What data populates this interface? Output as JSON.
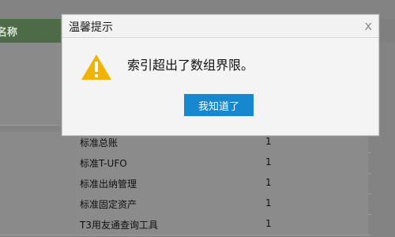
{
  "table": {
    "header_fragment": "名称",
    "rows": [
      {
        "name": "标准总账",
        "value": "1"
      },
      {
        "name": "标准T-UFO",
        "value": "1"
      },
      {
        "name": "标准出纳管理",
        "value": "1"
      },
      {
        "name": "标准固定资产",
        "value": "1"
      },
      {
        "name": "T3用友通查询工具",
        "value": "1"
      }
    ]
  },
  "dialog": {
    "title": "温馨提示",
    "close_glyph": "x",
    "message": "索引超出了数组界限。",
    "button_label": "我知道了",
    "warning_icon": "warning-icon",
    "button_color": "#1787cf",
    "warning_color": "#f0b400"
  }
}
